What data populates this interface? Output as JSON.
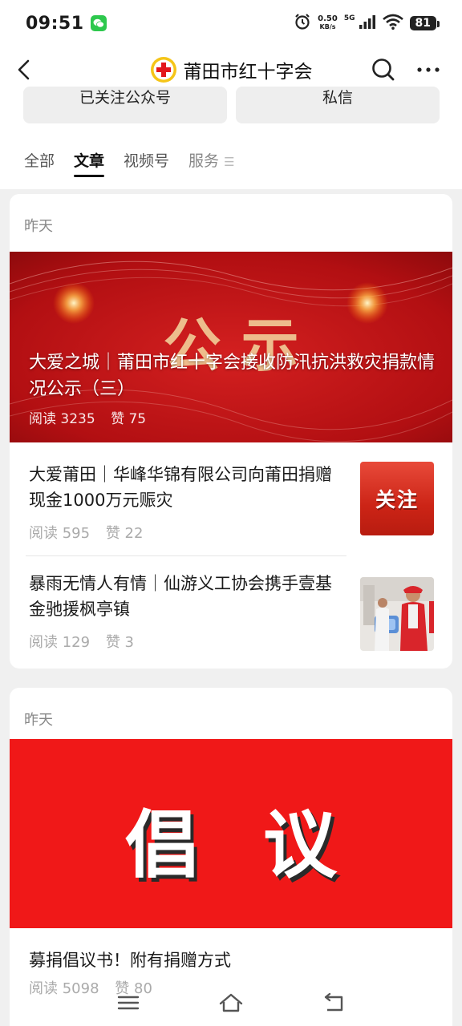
{
  "status_bar": {
    "time": "09:51",
    "net_speed_value": "0.50",
    "net_speed_unit": "KB/s",
    "signal_label": "5G",
    "battery": "81"
  },
  "header": {
    "title": "莆田市红十字会"
  },
  "actions": {
    "follow_label": "已关注公众号",
    "message_label": "私信"
  },
  "tabs": [
    {
      "label": "全部",
      "active": false
    },
    {
      "label": "文章",
      "active": true
    },
    {
      "label": "视频号",
      "active": false
    },
    {
      "label": "服务",
      "active": false
    }
  ],
  "tab_overflow_glyph": "☰",
  "cards": [
    {
      "date": "昨天",
      "banner_watermark": "公 示",
      "featured": {
        "title": "大爱之城｜莆田市红十字会接收防汛抗洪救灾捐款情况公示（三）",
        "reads": "阅读 3235",
        "likes": "赞 75"
      },
      "articles": [
        {
          "title": "大爱莆田｜华峰华锦有限公司向莆田捐赠现金1000万元赈灾",
          "reads": "阅读 595",
          "likes": "赞 22",
          "thumb_label": "关注"
        },
        {
          "title": "暴雨无情人有情｜仙游义工协会携手壹基金驰援枫亭镇",
          "reads": "阅读 129",
          "likes": "赞 3"
        }
      ]
    },
    {
      "date": "昨天",
      "banner_text": "倡议",
      "title": "募捐倡议书！附有捐赠方式",
      "reads": "阅读 5098",
      "likes": "赞 80"
    }
  ],
  "colors": {
    "banner_red": "#c41212",
    "banner_gold": "#f4d9a0",
    "proposal_red": "#f01818",
    "thumb_red": "#d42a1c",
    "wechat_green": "#2dc84d"
  },
  "icons": [
    "back-arrow-icon",
    "red-cross-logo-icon",
    "search-icon",
    "more-icon",
    "wechat-icon",
    "alarm-icon",
    "signal-icon",
    "wifi-icon",
    "menu-icon",
    "home-icon",
    "return-icon"
  ]
}
